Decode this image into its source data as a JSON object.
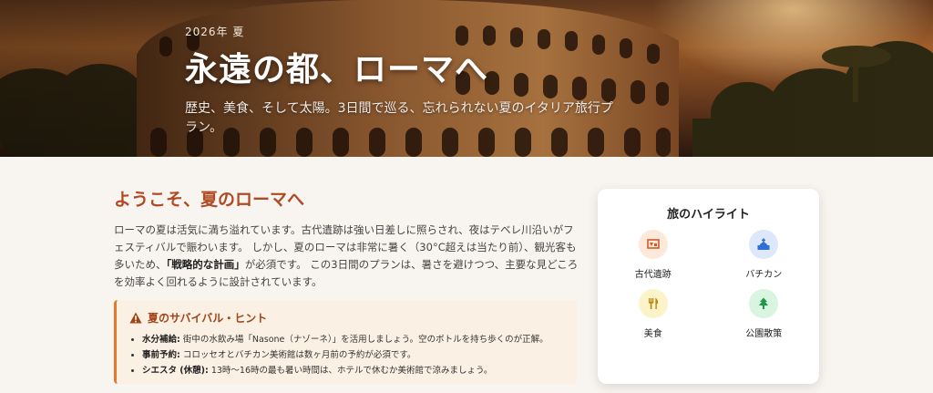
{
  "hero": {
    "eyebrow": "2026年 夏",
    "title": "永遠の都、ローマへ",
    "subtitle": "歴史、美食、そして太陽。3日間で巡る、忘れられない夏のイタリア旅行プラン。"
  },
  "intro": {
    "title": "ようこそ、夏のローマへ",
    "text_1": "ローマの夏は活気に満ち溢れています。古代遺跡は強い日差しに照らされ、夜はテベレ川沿いがフェスティバルで賑わいます。 しかし、夏のローマは非常に暑く（30°C超えは当たり前）、観光客も多いため、",
    "text_bold": "「戦略的な計画」",
    "text_2": "が必須です。 この3日間のプランは、暑さを避けつつ、主要な見どころを効率よく回れるように設計されています。"
  },
  "tips": {
    "title": "夏のサバイバル・ヒント",
    "items": [
      {
        "label": "水分補給:",
        "text": " 街中の水飲み場「Nasone（ナゾーネ）」を活用しましょう。空のボトルを持ち歩くのが正解。"
      },
      {
        "label": "事前予約:",
        "text": " コロッセオとバチカン美術館は数ヶ月前の予約が必須です。"
      },
      {
        "label": "シエスタ (休憩):",
        "text": " 13時〜16時の最も暑い時間は、ホテルで休むか美術館で涼みましょう。"
      }
    ]
  },
  "highlights": {
    "title": "旅のハイライト",
    "items": [
      {
        "label": "古代遺跡",
        "icon": "ruins-icon",
        "color": "#d9582b",
        "bg": "#fde9d9"
      },
      {
        "label": "バチカン",
        "icon": "church-icon",
        "color": "#2f6fd6",
        "bg": "#dde8fb"
      },
      {
        "label": "美食",
        "icon": "utensils-icon",
        "color": "#b8860b",
        "bg": "#fcf3c8"
      },
      {
        "label": "公園散策",
        "icon": "tree-icon",
        "color": "#1f9a4a",
        "bg": "#d9f4e1"
      }
    ]
  },
  "colors": {
    "accent": "#b04a22",
    "tip_border": "#e07a2e",
    "background": "#f8f4f0"
  }
}
